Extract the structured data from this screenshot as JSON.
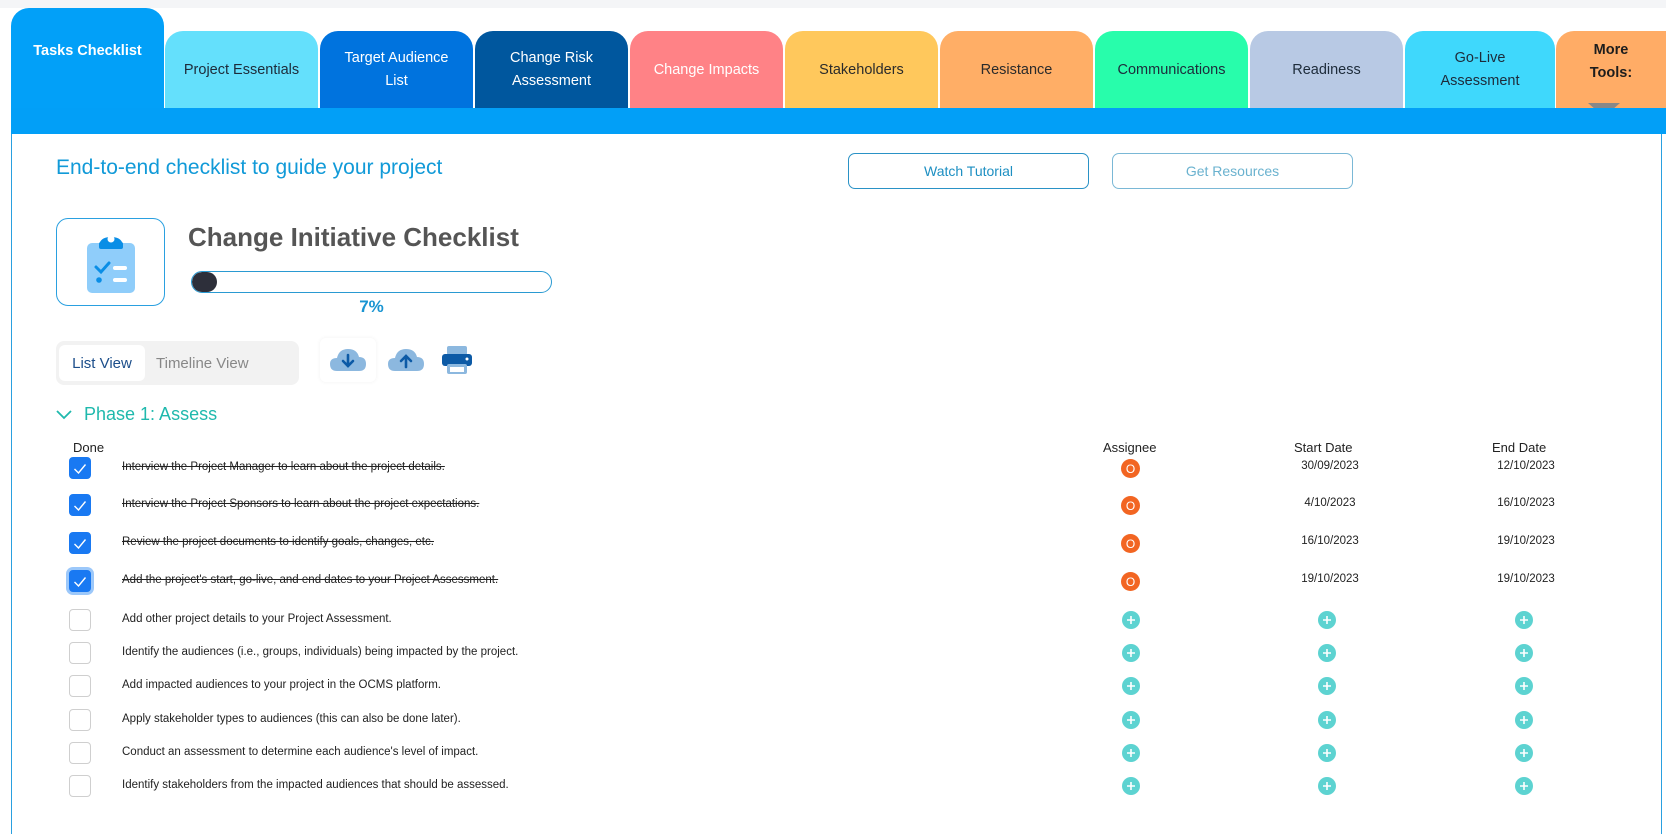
{
  "tabs": [
    {
      "label": "Tasks Checklist",
      "bg": "#02a0f8",
      "fg": "#ffffff",
      "active": true
    },
    {
      "label": "Project Essentials",
      "bg": "#64e0fc",
      "fg": "#1d2b3a"
    },
    {
      "label": "Target Audience List",
      "bg": "#0073de",
      "fg": "#ffffff"
    },
    {
      "label": "Change Risk Assessment",
      "bg": "#00579e",
      "fg": "#ffffff"
    },
    {
      "label": "Change Impacts",
      "bg": "#ff8286",
      "fg": "#ffffff"
    },
    {
      "label": "Stakeholders",
      "bg": "#ffc85c",
      "fg": "#2b2b2b"
    },
    {
      "label": "Resistance",
      "bg": "#ffae66",
      "fg": "#2b2b2b"
    },
    {
      "label": "Communications",
      "bg": "#28fdab",
      "fg": "#1d2b3a"
    },
    {
      "label": "Readiness",
      "bg": "#b8c9e4",
      "fg": "#1d2b3a"
    },
    {
      "label": "Go-Live Assessment",
      "bg": "#3fd8fc",
      "fg": "#1d2b3a"
    },
    {
      "label": "More Tools:",
      "bg": "#ffac66",
      "fg": "#1d1d1d"
    }
  ],
  "header": {
    "subtitle": "End-to-end checklist to guide your project",
    "watch_tutorial": "Watch Tutorial",
    "get_resources": "Get Resources"
  },
  "checklist": {
    "title": "Change Initiative Checklist",
    "progress_percent": 7,
    "progress_label": "7%"
  },
  "view_toggle": {
    "list": "List View",
    "timeline": "Timeline View",
    "selected": "List View"
  },
  "toolbar": {
    "icons": [
      "cloud-download-icon",
      "cloud-upload-icon",
      "printer-icon"
    ]
  },
  "phase": {
    "label": "Phase 1: Assess",
    "expanded": true
  },
  "columns": {
    "done": "Done",
    "assignee": "Assignee",
    "start": "Start Date",
    "end": "End Date"
  },
  "tasks": [
    {
      "text": "Interview the Project Manager to learn about the project details.",
      "done": true,
      "assignee": "O",
      "start": "30/09/2023",
      "end": "12/10/2023"
    },
    {
      "text": "Interview the Project Sponsors to learn about the project expectations.",
      "done": true,
      "assignee": "O",
      "start": "4/10/2023",
      "end": "16/10/2023"
    },
    {
      "text": "Review the project documents to identify goals, changes, etc.",
      "done": true,
      "assignee": "O",
      "start": "16/10/2023",
      "end": "19/10/2023"
    },
    {
      "text": "Add the project's start, go-live, and end dates to your Project Assessment.",
      "done": true,
      "assignee": "O",
      "start": "19/10/2023",
      "end": "19/10/2023",
      "focused": true
    },
    {
      "text": "Add other project details to your Project Assessment.",
      "done": false
    },
    {
      "text": "Identify the audiences (i.e., groups, individuals) being impacted by the project.",
      "done": false
    },
    {
      "text": "Add impacted audiences to your project in the OCMS platform.",
      "done": false
    },
    {
      "text": "Apply stakeholder types to audiences (this can also be done later).",
      "done": false
    },
    {
      "text": "Conduct an assessment to determine each audience's level of impact.",
      "done": false
    },
    {
      "text": "Identify stakeholders from the impacted audiences that should be assessed.",
      "done": false
    }
  ]
}
